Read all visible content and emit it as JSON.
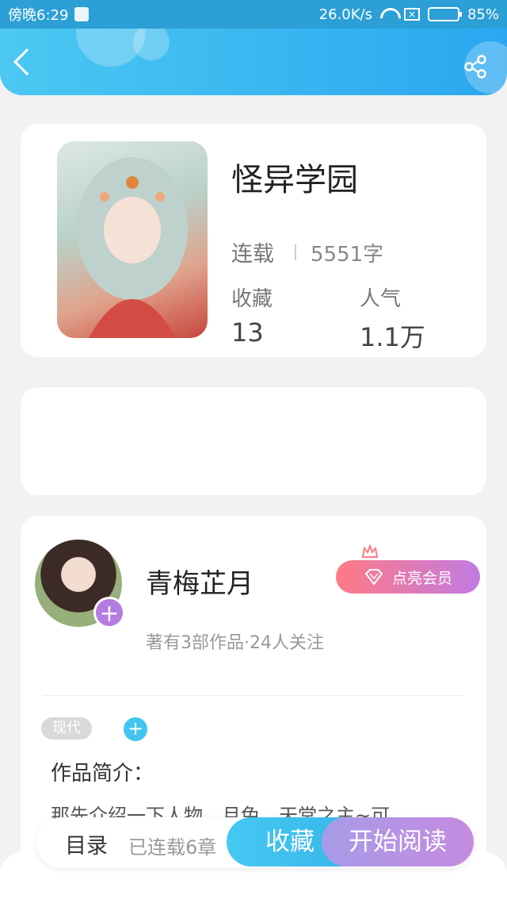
{
  "statusbar": {
    "time": "傍晚6:29",
    "speed": "26.0K/s",
    "battery": "85%",
    "battery_level": 0.85
  },
  "header": {
    "back_icon": "chevron-left-icon",
    "share_icon": "share-icon"
  },
  "book": {
    "title": "怪异学园",
    "status": "连载",
    "wordcount": "5551字",
    "fav_label": "收藏",
    "fav_value": "13",
    "pop_label": "人气",
    "pop_value": "1.1万"
  },
  "author": {
    "name": "青梅芷月",
    "meta": "著有3部作品·24人关注",
    "vip_label": "点亮会员"
  },
  "tags": [
    "现代"
  ],
  "intro": {
    "title": "作品简介：",
    "text": "那先介绍一下人物，月兔，天堂之主~可"
  },
  "bottom": {
    "toc": "目录",
    "chapters": "已连载6章",
    "fav_button": "收藏",
    "read_button": "开始阅读"
  },
  "colors": {
    "header_start": "#4cc8f2",
    "header_end": "#2aa7f0",
    "fav_button": "#45c9f2",
    "read_button": "#b893e4",
    "vip_button": "#ff7a85"
  }
}
